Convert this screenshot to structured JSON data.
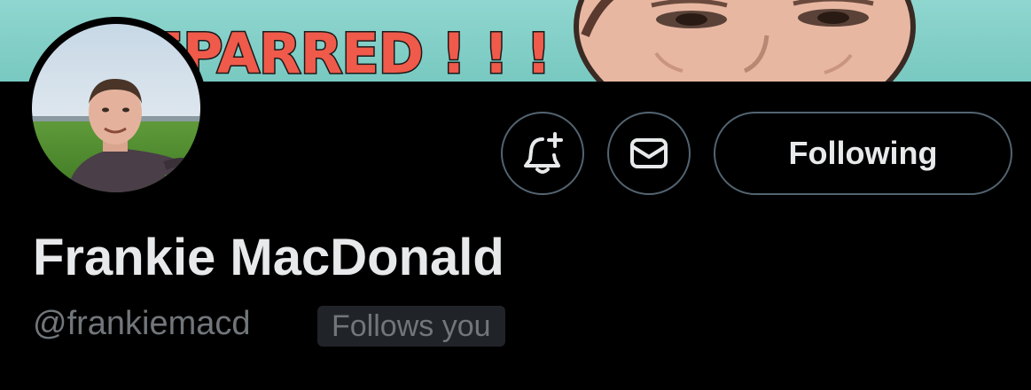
{
  "banner": {
    "text": "REPARRED ! ! !"
  },
  "profile": {
    "display_name": "Frankie MacDonald",
    "handle": "@frankiemacd",
    "follows_you_label": "Follows you"
  },
  "actions": {
    "notify_icon": "bell-plus-icon",
    "message_icon": "envelope-icon",
    "follow_label": "Following"
  },
  "colors": {
    "background": "#000000",
    "banner": "#8fd6cf",
    "banner_text": "#ef5a4a",
    "button_border": "#536471",
    "primary_text": "#e7e9ea",
    "secondary_text": "#71767b",
    "badge_bg": "#202327"
  }
}
